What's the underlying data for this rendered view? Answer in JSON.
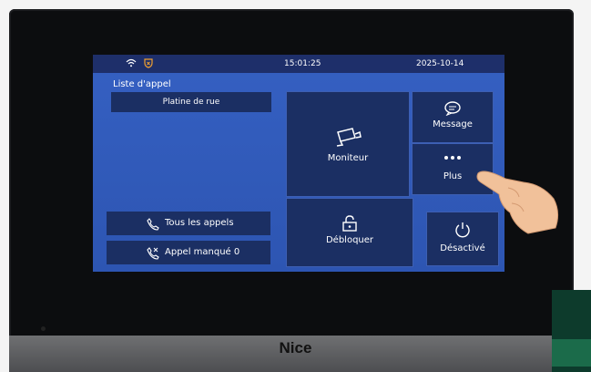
{
  "status": {
    "time": "15:01:25",
    "date": "2025-10-14",
    "wifi_icon": "wifi-icon",
    "shield_icon": "shield-icon"
  },
  "call_list": {
    "title": "Liste d'appel",
    "source": "Platine de rue",
    "all_calls": "Tous les appels",
    "missed_calls": "Appel manqué 0"
  },
  "tiles": {
    "monitor": "Moniteur",
    "message": "Message",
    "more": "Plus",
    "unlock": "Débloquer",
    "deactivate": "Désactivé"
  },
  "device": {
    "brand": "Nice"
  },
  "colors": {
    "screen": "#2f58b8",
    "tile": "#1b2f63",
    "statusbar": "#1e2f6a"
  }
}
